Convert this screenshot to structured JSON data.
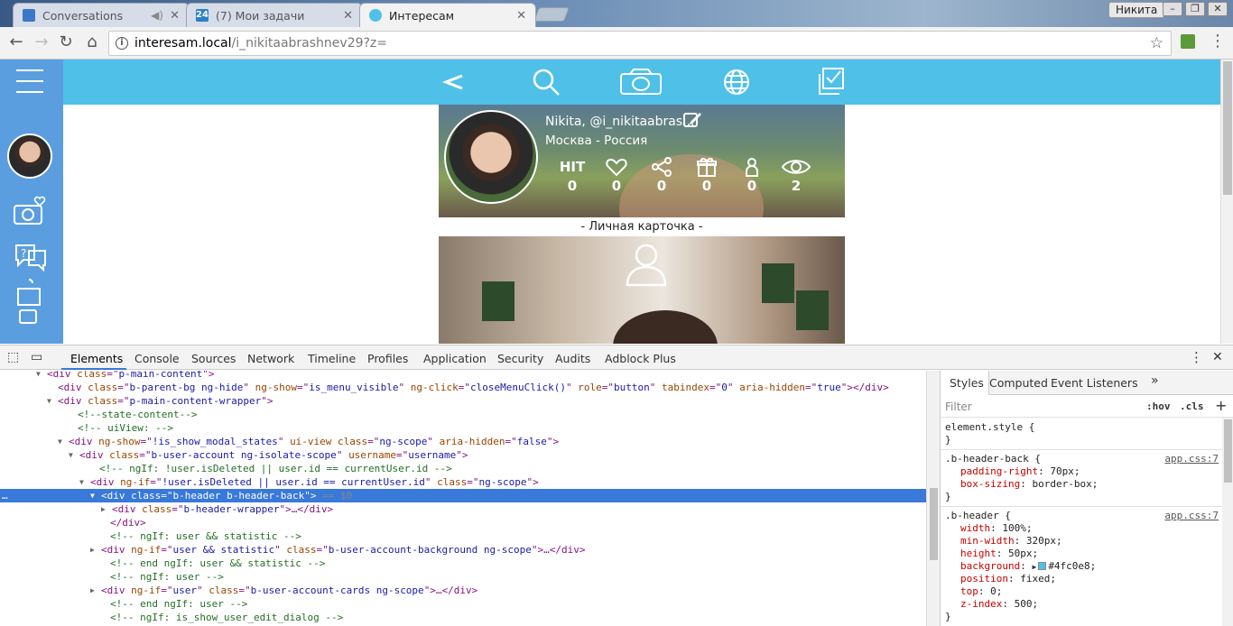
{
  "browser": {
    "tabs": [
      {
        "title": "Conversations"
      },
      {
        "title": "(7) Мои задачи"
      },
      {
        "title": "Интересам"
      }
    ],
    "profile_name": "Никита",
    "url_host": "interesam.local",
    "url_path": "/i_nikitaabrashnev29?z="
  },
  "page": {
    "user_name": "Nikita, @i_nikitaabras...",
    "user_location": "Москва - Россия",
    "stats": [
      {
        "label": "НIТ",
        "icon": "hit-icon",
        "value": "0"
      },
      {
        "label": "",
        "icon": "heart-icon",
        "value": "0"
      },
      {
        "label": "",
        "icon": "share-icon",
        "value": "0"
      },
      {
        "label": "",
        "icon": "gift-icon",
        "value": "0"
      },
      {
        "label": "",
        "icon": "person-icon",
        "value": "0"
      },
      {
        "label": "",
        "icon": "eye-icon",
        "value": "2"
      }
    ],
    "card_label": "- Личная карточка -",
    "accent_color": "#4fc0e8",
    "sidebar_color": "#5a9ee0"
  },
  "devtools": {
    "tabs": [
      "Elements",
      "Console",
      "Sources",
      "Network",
      "Timeline",
      "Profiles",
      "Application",
      "Security",
      "Audits",
      "Adblock Plus"
    ],
    "dom_lines": [
      {
        "indent": 52,
        "arrow": "▼",
        "parts": [
          [
            "tg",
            "<div "
          ],
          [
            "an",
            "class"
          ],
          [
            "tg",
            "=\""
          ],
          [
            "av",
            "p-main-content"
          ],
          [
            "tg",
            "\">"
          ]
        ]
      },
      {
        "indent": 64,
        "arrow": "",
        "parts": [
          [
            "tg",
            "<div "
          ],
          [
            "an",
            "class"
          ],
          [
            "tg",
            "=\""
          ],
          [
            "av",
            "b-parent-bg ng-hide"
          ],
          [
            "tg",
            "\" "
          ],
          [
            "an",
            "ng-show"
          ],
          [
            "tg",
            "=\""
          ],
          [
            "av",
            "is_menu_visible"
          ],
          [
            "tg",
            "\" "
          ],
          [
            "an",
            "ng-click"
          ],
          [
            "tg",
            "=\""
          ],
          [
            "av",
            "closeMenuClick()"
          ],
          [
            "tg",
            "\" "
          ],
          [
            "an",
            "role"
          ],
          [
            "tg",
            "=\""
          ],
          [
            "av",
            "button"
          ],
          [
            "tg",
            "\" "
          ],
          [
            "an",
            "tabindex"
          ],
          [
            "tg",
            "=\""
          ],
          [
            "av",
            "0"
          ],
          [
            "tg",
            "\" "
          ],
          [
            "an",
            "aria-hidden"
          ],
          [
            "tg",
            "=\""
          ],
          [
            "av",
            "true"
          ],
          [
            "tg",
            "\"></div>"
          ]
        ]
      },
      {
        "indent": 64,
        "arrow": "▼",
        "parts": [
          [
            "tg",
            "<div "
          ],
          [
            "an",
            "class"
          ],
          [
            "tg",
            "=\""
          ],
          [
            "av",
            "p-main-content-wrapper"
          ],
          [
            "tg",
            "\">"
          ]
        ]
      },
      {
        "indent": 86,
        "arrow": "",
        "parts": [
          [
            "cm",
            "<!--state-content-->"
          ]
        ]
      },
      {
        "indent": 86,
        "arrow": "",
        "parts": [
          [
            "cm",
            "<!-- uiView: -->"
          ]
        ]
      },
      {
        "indent": 76,
        "arrow": "▼",
        "parts": [
          [
            "tg",
            "<div "
          ],
          [
            "an",
            "ng-show"
          ],
          [
            "tg",
            "=\""
          ],
          [
            "av",
            "!is_show_modal_states"
          ],
          [
            "tg",
            "\" "
          ],
          [
            "an",
            "ui-view"
          ],
          [
            "tg",
            " "
          ],
          [
            "an",
            "class"
          ],
          [
            "tg",
            "=\""
          ],
          [
            "av",
            "ng-scope"
          ],
          [
            "tg",
            "\" "
          ],
          [
            "an",
            "aria-hidden"
          ],
          [
            "tg",
            "=\""
          ],
          [
            "av",
            "false"
          ],
          [
            "tg",
            "\">"
          ]
        ]
      },
      {
        "indent": 88,
        "arrow": "▼",
        "parts": [
          [
            "tg",
            "<div "
          ],
          [
            "an",
            "class"
          ],
          [
            "tg",
            "=\""
          ],
          [
            "av",
            "b-user-account ng-isolate-scope"
          ],
          [
            "tg",
            "\" "
          ],
          [
            "an",
            "username"
          ],
          [
            "tg",
            "=\""
          ],
          [
            "av",
            "username"
          ],
          [
            "tg",
            "\">"
          ]
        ]
      },
      {
        "indent": 110,
        "arrow": "",
        "parts": [
          [
            "cm",
            "<!-- ngIf: !user.isDeleted || user.id == currentUser.id -->"
          ]
        ]
      },
      {
        "indent": 100,
        "arrow": "▼",
        "parts": [
          [
            "tg",
            "<div "
          ],
          [
            "an",
            "ng-if"
          ],
          [
            "tg",
            "=\""
          ],
          [
            "av",
            "!user.isDeleted || user.id == currentUser.id"
          ],
          [
            "tg",
            "\" "
          ],
          [
            "an",
            "class"
          ],
          [
            "tg",
            "=\""
          ],
          [
            "av",
            "ng-scope"
          ],
          [
            "tg",
            "\">"
          ]
        ]
      },
      {
        "indent": 112,
        "arrow": "▼",
        "sel": true,
        "parts": [
          [
            "tg",
            "<div "
          ],
          [
            "an",
            "class"
          ],
          [
            "tg",
            "=\""
          ],
          [
            "av",
            "b-header b-header-back"
          ],
          [
            "tg",
            "\">"
          ],
          [
            "eq",
            " == $0"
          ]
        ]
      },
      {
        "indent": 124,
        "arrow": "▶",
        "parts": [
          [
            "tg",
            "<div "
          ],
          [
            "an",
            "class"
          ],
          [
            "tg",
            "=\""
          ],
          [
            "av",
            "b-header-wrapper"
          ],
          [
            "tg",
            "\">…</div>"
          ]
        ]
      },
      {
        "indent": 122,
        "arrow": "",
        "parts": [
          [
            "tg",
            "</div>"
          ]
        ]
      },
      {
        "indent": 122,
        "arrow": "",
        "parts": [
          [
            "cm",
            "<!-- ngIf: user && statistic -->"
          ]
        ]
      },
      {
        "indent": 112,
        "arrow": "▶",
        "parts": [
          [
            "tg",
            "<div "
          ],
          [
            "an",
            "ng-if"
          ],
          [
            "tg",
            "=\""
          ],
          [
            "av",
            "user && statistic"
          ],
          [
            "tg",
            "\" "
          ],
          [
            "an",
            "class"
          ],
          [
            "tg",
            "=\""
          ],
          [
            "av",
            "b-user-account-background ng-scope"
          ],
          [
            "tg",
            "\">…</div>"
          ]
        ]
      },
      {
        "indent": 122,
        "arrow": "",
        "parts": [
          [
            "cm",
            "<!-- end ngIf: user && statistic -->"
          ]
        ]
      },
      {
        "indent": 122,
        "arrow": "",
        "parts": [
          [
            "cm",
            "<!-- ngIf: user -->"
          ]
        ]
      },
      {
        "indent": 112,
        "arrow": "▶",
        "parts": [
          [
            "tg",
            "<div "
          ],
          [
            "an",
            "ng-if"
          ],
          [
            "tg",
            "=\""
          ],
          [
            "av",
            "user"
          ],
          [
            "tg",
            "\" "
          ],
          [
            "an",
            "class"
          ],
          [
            "tg",
            "=\""
          ],
          [
            "av",
            "b-user-account-cards ng-scope"
          ],
          [
            "tg",
            "\">…</div>"
          ]
        ]
      },
      {
        "indent": 122,
        "arrow": "",
        "parts": [
          [
            "cm",
            "<!-- end ngIf: user -->"
          ]
        ]
      },
      {
        "indent": 122,
        "arrow": "",
        "parts": [
          [
            "cm",
            "<!-- ngIf: is_show_user_edit_dialog -->"
          ]
        ]
      }
    ],
    "styles_tabs": [
      "Styles",
      "Computed",
      "Event Listeners"
    ],
    "filter_placeholder": "Filter",
    "hov": ":hov",
    "cls": ".cls",
    "rules": [
      {
        "selector": "element.style",
        "source": "",
        "props": []
      },
      {
        "selector": ".b-header-back",
        "source": "app.css:7",
        "props": [
          [
            "padding-right",
            "70px"
          ],
          [
            "box-sizing",
            "border-box"
          ]
        ]
      },
      {
        "selector": ".b-header",
        "source": "app.css:7",
        "props": [
          [
            "width",
            "100%"
          ],
          [
            "min-width",
            "320px"
          ],
          [
            "height",
            "50px"
          ],
          [
            "background",
            "#4fc0e8"
          ],
          [
            "position",
            "fixed"
          ],
          [
            "top",
            "0"
          ],
          [
            "z-index",
            "500"
          ]
        ]
      }
    ]
  }
}
